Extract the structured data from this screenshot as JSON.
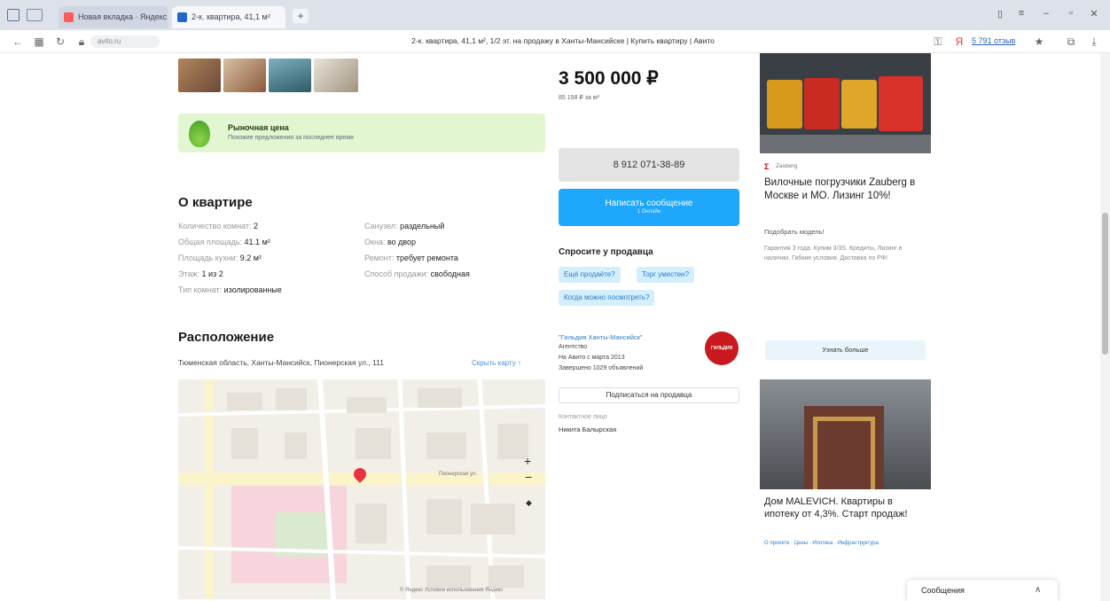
{
  "browser": {
    "tabs": [
      {
        "label": "Новая вкладка · Яндекс"
      },
      {
        "label": "2-к. квартира, 41,1 м²"
      }
    ],
    "page_title": "2-к. квартира, 41,1 м², 1/2 эт. на продажу в Ханты-Мансийске | Купить квартиру | Авито",
    "url_short": "avito.ru",
    "bookmark_label": "5 791 отзыв",
    "new_tab_symbol": "+"
  },
  "listing": {
    "promo": {
      "title": "Рыночная цена",
      "subtitle": "Похожие предложения за последнее время"
    },
    "about_title": "О квартире",
    "params_left": [
      {
        "label": "Количество комнат:",
        "value": "2"
      },
      {
        "label": "Общая площадь:",
        "value": "41.1 м²"
      },
      {
        "label": "Площадь кухни:",
        "value": "9.2 м²"
      },
      {
        "label": "Этаж:",
        "value": "1 из 2"
      },
      {
        "label": "Тип комнат:",
        "value": "изолированные"
      }
    ],
    "params_right": [
      {
        "label": "Санузел:",
        "value": "раздельный"
      },
      {
        "label": "Окна:",
        "value": "во двор"
      },
      {
        "label": "Ремонт:",
        "value": "требует ремонта"
      },
      {
        "label": "Способ продажи:",
        "value": "свободная"
      }
    ],
    "location_title": "Расположение",
    "address": "Тюменская область, Ханты-Мансийск, Пионерская ул., 111",
    "show_map": "Скрыть карту ↑",
    "map_street": "Пионерская ул.",
    "map_copyright": "© Яндекс  Условия использования  Яндекс"
  },
  "sidebar": {
    "price": "3 500 000 ₽",
    "price_per_meter": "85 158 ₽ за м²",
    "phone": "8 912 071-38-89",
    "message_btn": "Написать сообщение",
    "message_sub": "1 Онлайн",
    "ask_title": "Спросите у продавца",
    "chips": [
      "Ещё продаёте?",
      "Торг уместен?",
      "Когда можно посмотреть?"
    ],
    "agency_name": "\"Гильдия Ханты-Мансийск\"",
    "agency_type": "Агентство",
    "agency_since": "На Авито с марта 2013",
    "agency_count": "Завершено 1029 объявлений",
    "avatar_label": "ГИЛЬДИЯ",
    "subscribe_btn": "Подписаться на продавца",
    "contact_label": "Контактное лицо",
    "contact_name": "Никита Балырская"
  },
  "ads": {
    "ad1_brand": "Zauberg",
    "ad1_title": "Вилочные погрузчики Zauberg в Москве и МО. Лизинг 10%!",
    "ad1_link": "Подобрать модель!",
    "ad1_text": "Гарантия 3 года. Купим 3/3S. Кредиты, Лизинг в наличии. Гибкие условия. Доставка по РФ!",
    "ad1_btn": "Узнать больше",
    "ad2_title": "Дом MALEVICH. Квартиры в ипотеку от 4,3%. Старт продаж!",
    "ad2_links": "О проекте · Цены · Ипотека · Инфраструктура"
  },
  "messenger": {
    "label": "Сообщения",
    "chevron": "∧"
  }
}
